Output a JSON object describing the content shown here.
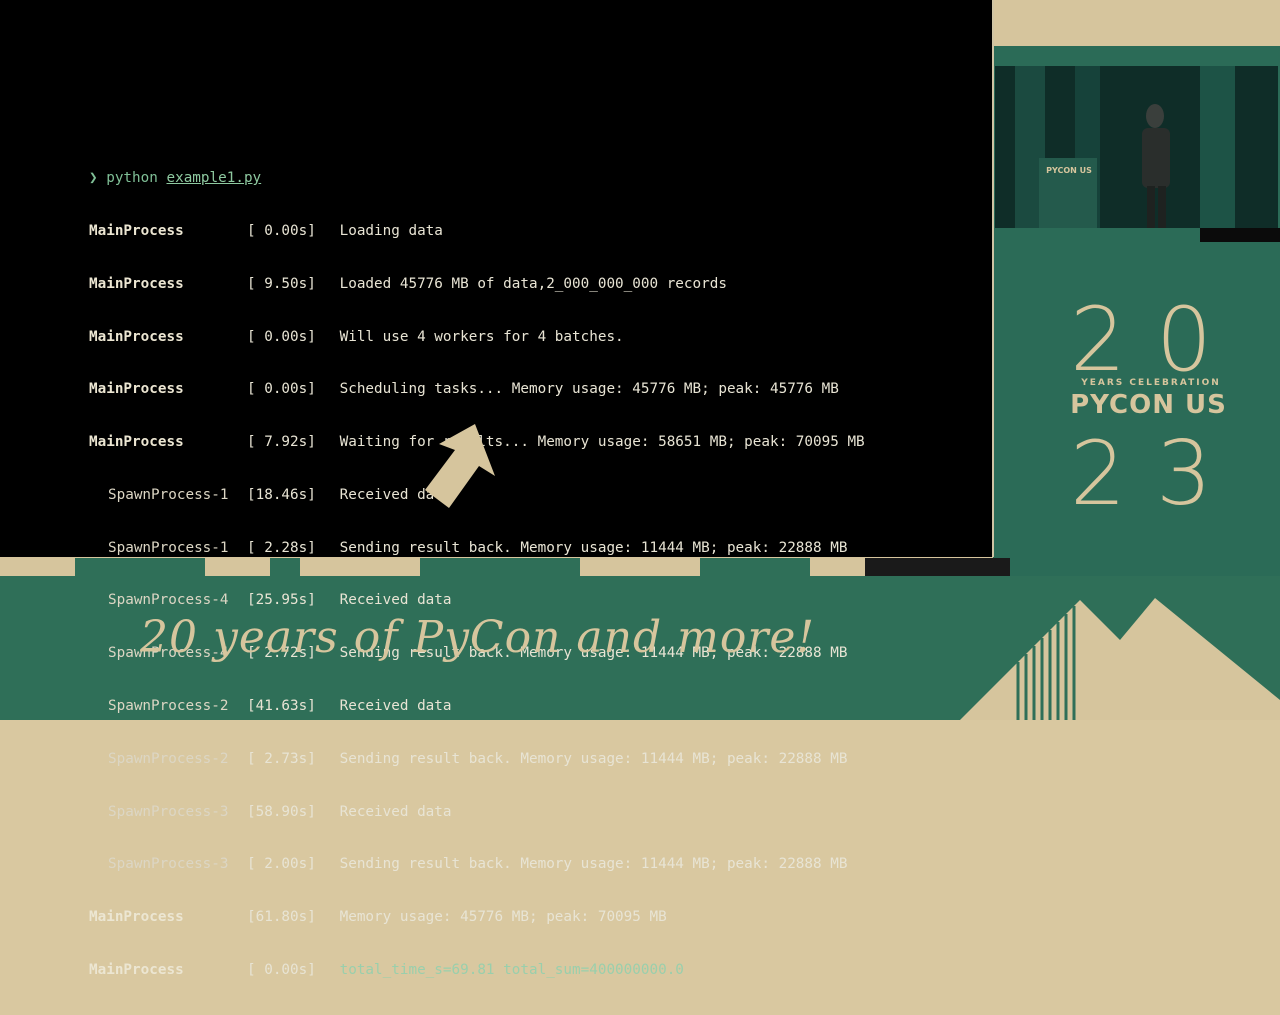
{
  "terminal": {
    "prompt_symbol": "❯",
    "command": "python",
    "command_arg": "example1.py",
    "lines": [
      {
        "proc": "MainProcess",
        "time": "[ 0.00s]",
        "msg": "Loading data"
      },
      {
        "proc": "MainProcess",
        "time": "[ 9.50s]",
        "msg": "Loaded 45776 MB of data,2_000_000_000 records"
      },
      {
        "proc": "MainProcess",
        "time": "[ 0.00s]",
        "msg": "Will use 4 workers for 4 batches."
      },
      {
        "proc": "MainProcess",
        "time": "[ 0.00s]",
        "msg": "Scheduling tasks... Memory usage: 45776 MB; peak: 45776 MB"
      },
      {
        "proc": "MainProcess",
        "time": "[ 7.92s]",
        "msg": "Waiting for results... Memory usage: 58651 MB; peak: 70095 MB"
      },
      {
        "proc": "SpawnProcess-1",
        "time": "[18.46s]",
        "msg": "Received data"
      },
      {
        "proc": "SpawnProcess-1",
        "time": "[ 2.28s]",
        "msg": "Sending result back. Memory usage: 11444 MB; peak: 22888 MB"
      },
      {
        "proc": "SpawnProcess-4",
        "time": "[25.95s]",
        "msg": "Received data"
      },
      {
        "proc": "SpawnProcess-4",
        "time": "[ 2.72s]",
        "msg": "Sending result back. Memory usage: 11444 MB; peak: 22888 MB"
      },
      {
        "proc": "SpawnProcess-2",
        "time": "[41.63s]",
        "msg": "Received data"
      },
      {
        "proc": "SpawnProcess-2",
        "time": "[ 2.73s]",
        "msg": "Sending result back. Memory usage: 11444 MB; peak: 22888 MB"
      },
      {
        "proc": "SpawnProcess-3",
        "time": "[58.90s]",
        "msg": "Received data"
      },
      {
        "proc": "SpawnProcess-3",
        "time": "[ 2.00s]",
        "msg": "Sending result back. Memory usage: 11444 MB; peak: 22888 MB"
      },
      {
        "proc": "MainProcess",
        "time": "[61.80s]",
        "msg": "Memory usage: 45776 MB; peak: 70095 MB"
      },
      {
        "proc": "MainProcess",
        "time": "[ 0.00s]",
        "msg": "total_time_s=69.81 total_sum=400000000.0"
      }
    ]
  },
  "video": {
    "lectern_label": "PYCON US"
  },
  "branding": {
    "year_top": "20",
    "caption": "YEARS CELEBRATION",
    "title": "PYCON US",
    "year_bottom": "23",
    "tagline": "20 years of PyCon and more!"
  },
  "colors": {
    "green": "#2f6f58",
    "beige": "#d6c59d",
    "terminal_bg": "#000000"
  },
  "icons": [
    "arrow-pointer-icon",
    "mountain-graphic"
  ]
}
